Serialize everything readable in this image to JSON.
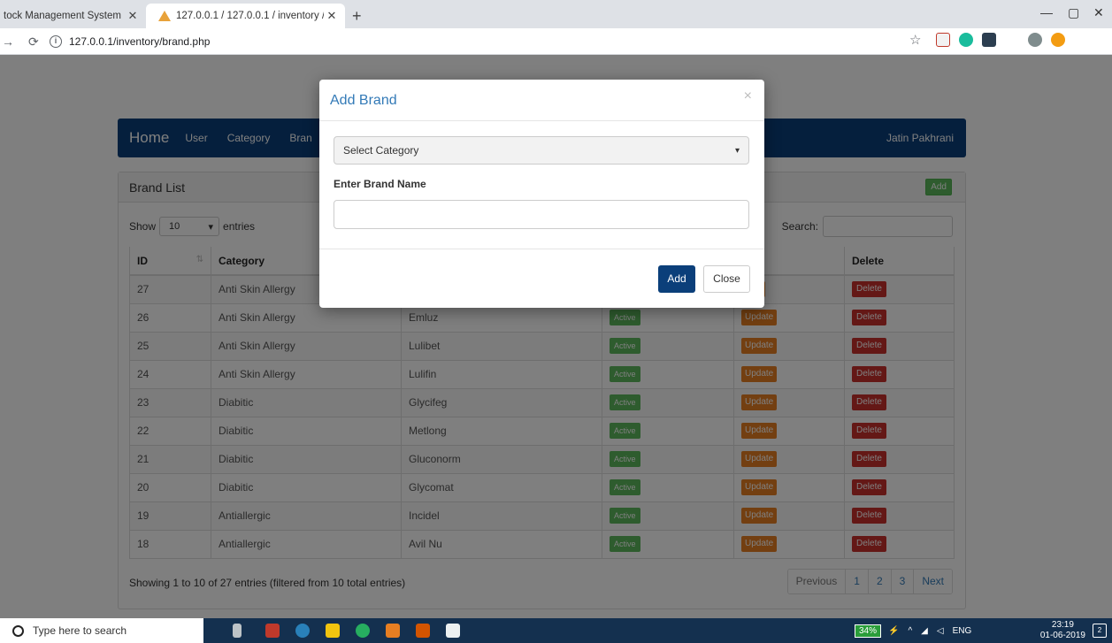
{
  "browser": {
    "tabs": [
      {
        "title": "tock Management System"
      },
      {
        "title": "127.0.0.1 / 127.0.0.1 / inventory / "
      }
    ],
    "url": "127.0.0.1/inventory/brand.php",
    "icons": {
      "back": "back-arrow-icon",
      "reload": "reload-icon",
      "info": "info-icon",
      "star": "bookmark-star-icon"
    }
  },
  "navbar": {
    "brand": "Home",
    "items": [
      "User",
      "Category",
      "Bran"
    ],
    "user": "Jatin Pakhrani"
  },
  "panel": {
    "title": "Brand List",
    "add_label": "Add",
    "show_label": "Show",
    "entries_value": "10",
    "entries_label": "entries",
    "search_label": "Search:",
    "columns": [
      "ID",
      "Category",
      "",
      "",
      "",
      "Delete"
    ],
    "rows": [
      {
        "id": "27",
        "category": "Anti Skin Allergy",
        "brand": "",
        "status": "",
        "update": "date",
        "delete": "Delete"
      },
      {
        "id": "26",
        "category": "Anti Skin Allergy",
        "brand": "Emluz",
        "status": "Active",
        "update": "Update",
        "delete": "Delete"
      },
      {
        "id": "25",
        "category": "Anti Skin Allergy",
        "brand": "Lulibet",
        "status": "Active",
        "update": "Update",
        "delete": "Delete"
      },
      {
        "id": "24",
        "category": "Anti Skin Allergy",
        "brand": "Lulifin",
        "status": "Active",
        "update": "Update",
        "delete": "Delete"
      },
      {
        "id": "23",
        "category": "Diabitic",
        "brand": "Glycifeg",
        "status": "Active",
        "update": "Update",
        "delete": "Delete"
      },
      {
        "id": "22",
        "category": "Diabitic",
        "brand": "Metlong",
        "status": "Active",
        "update": "Update",
        "delete": "Delete"
      },
      {
        "id": "21",
        "category": "Diabitic",
        "brand": "Gluconorm",
        "status": "Active",
        "update": "Update",
        "delete": "Delete"
      },
      {
        "id": "20",
        "category": "Diabitic",
        "brand": "Glycomat",
        "status": "Active",
        "update": "Update",
        "delete": "Delete"
      },
      {
        "id": "19",
        "category": "Antiallergic",
        "brand": "Incidel",
        "status": "Active",
        "update": "Update",
        "delete": "Delete"
      },
      {
        "id": "18",
        "category": "Antiallergic",
        "brand": "Avil Nu",
        "status": "Active",
        "update": "Update",
        "delete": "Delete"
      }
    ],
    "footer_info": "Showing 1 to 10 of 27 entries (filtered from 10 total entries)",
    "pager": [
      "Previous",
      "1",
      "2",
      "3",
      "Next"
    ]
  },
  "modal": {
    "title": "Add Brand",
    "close_x": "×",
    "category_placeholder": "Select Category",
    "brand_label": "Enter Brand Name",
    "add_button": "Add",
    "close_button": "Close"
  },
  "taskbar": {
    "search_placeholder": "Type here to search",
    "battery": "34%",
    "lang": "ENG",
    "time": "23:19",
    "date": "01-06-2019",
    "notifications": "2"
  },
  "colors": {
    "navbar": "#0b3f7a",
    "active": "#5cb85c",
    "update": "#e67e22",
    "delete": "#c9302c",
    "taskbar": "#14304f"
  }
}
